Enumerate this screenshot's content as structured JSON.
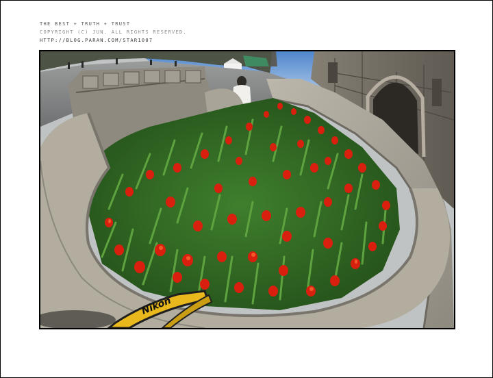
{
  "caption": {
    "line1": "THE BEST + TRUTH + TRUST",
    "line2": "COPYRIGHT (C) JUN. ALL RIGHTS RESERVED.",
    "line3": "HTTP://BLOG.PARAN.COM/STAR1007"
  },
  "photo": {
    "strap_brand": "Nikon",
    "colors": {
      "sky": "#6f9fd6",
      "stone": "#a8a49a",
      "stone_dark": "#6e6a62",
      "foliage": "#3d7a2e",
      "tulip_red": "#d9200e",
      "strap_yellow": "#e8b81c"
    }
  }
}
